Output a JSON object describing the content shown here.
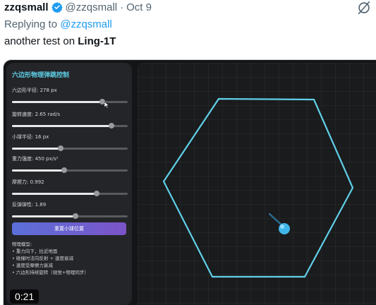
{
  "tweet": {
    "username": "zzqsmall",
    "handle": "@zzqsmall",
    "separator": "·",
    "date": "Oct 9",
    "reply_prefix": "Replying to",
    "reply_handle": "@zzqsmall",
    "text_prefix": "another test on",
    "text_bold": "Ling-1T"
  },
  "icons": {
    "verified": "verified-badge-icon",
    "grok": "grok-icon"
  },
  "colors": {
    "link": "#1d9bf0",
    "verified": "#1d9bf0",
    "accent_title": "#5fd0e8",
    "hexagon": "#5fd0e8",
    "ball": "#3fb6e8"
  },
  "app": {
    "title": "六边形物理弹跳控制",
    "controls": [
      {
        "label": "六边形半径: 278 px",
        "fraction": 0.78
      },
      {
        "label": "旋转速度: 2.65 rad/s",
        "fraction": 0.86
      },
      {
        "label": "小球半径: 16 px",
        "fraction": 0.42
      },
      {
        "label": "重力强度: 450 px/s²",
        "fraction": 0.45
      },
      {
        "label": "摩擦力: 0.992",
        "fraction": 0.73
      },
      {
        "label": "反弹弹性: 1.89",
        "fraction": 0.55
      }
    ],
    "reset_label": "重置小球位置",
    "model_title": "物理模型:",
    "model_lines": [
      "• 重力向下，拉近地面",
      "• 碰撞时法向反射 + 速度衰减",
      "• 速度受摩擦力衰减",
      "• 六边形持续旋转（视觉+物理同步）"
    ]
  },
  "video": {
    "time": "0:21"
  }
}
